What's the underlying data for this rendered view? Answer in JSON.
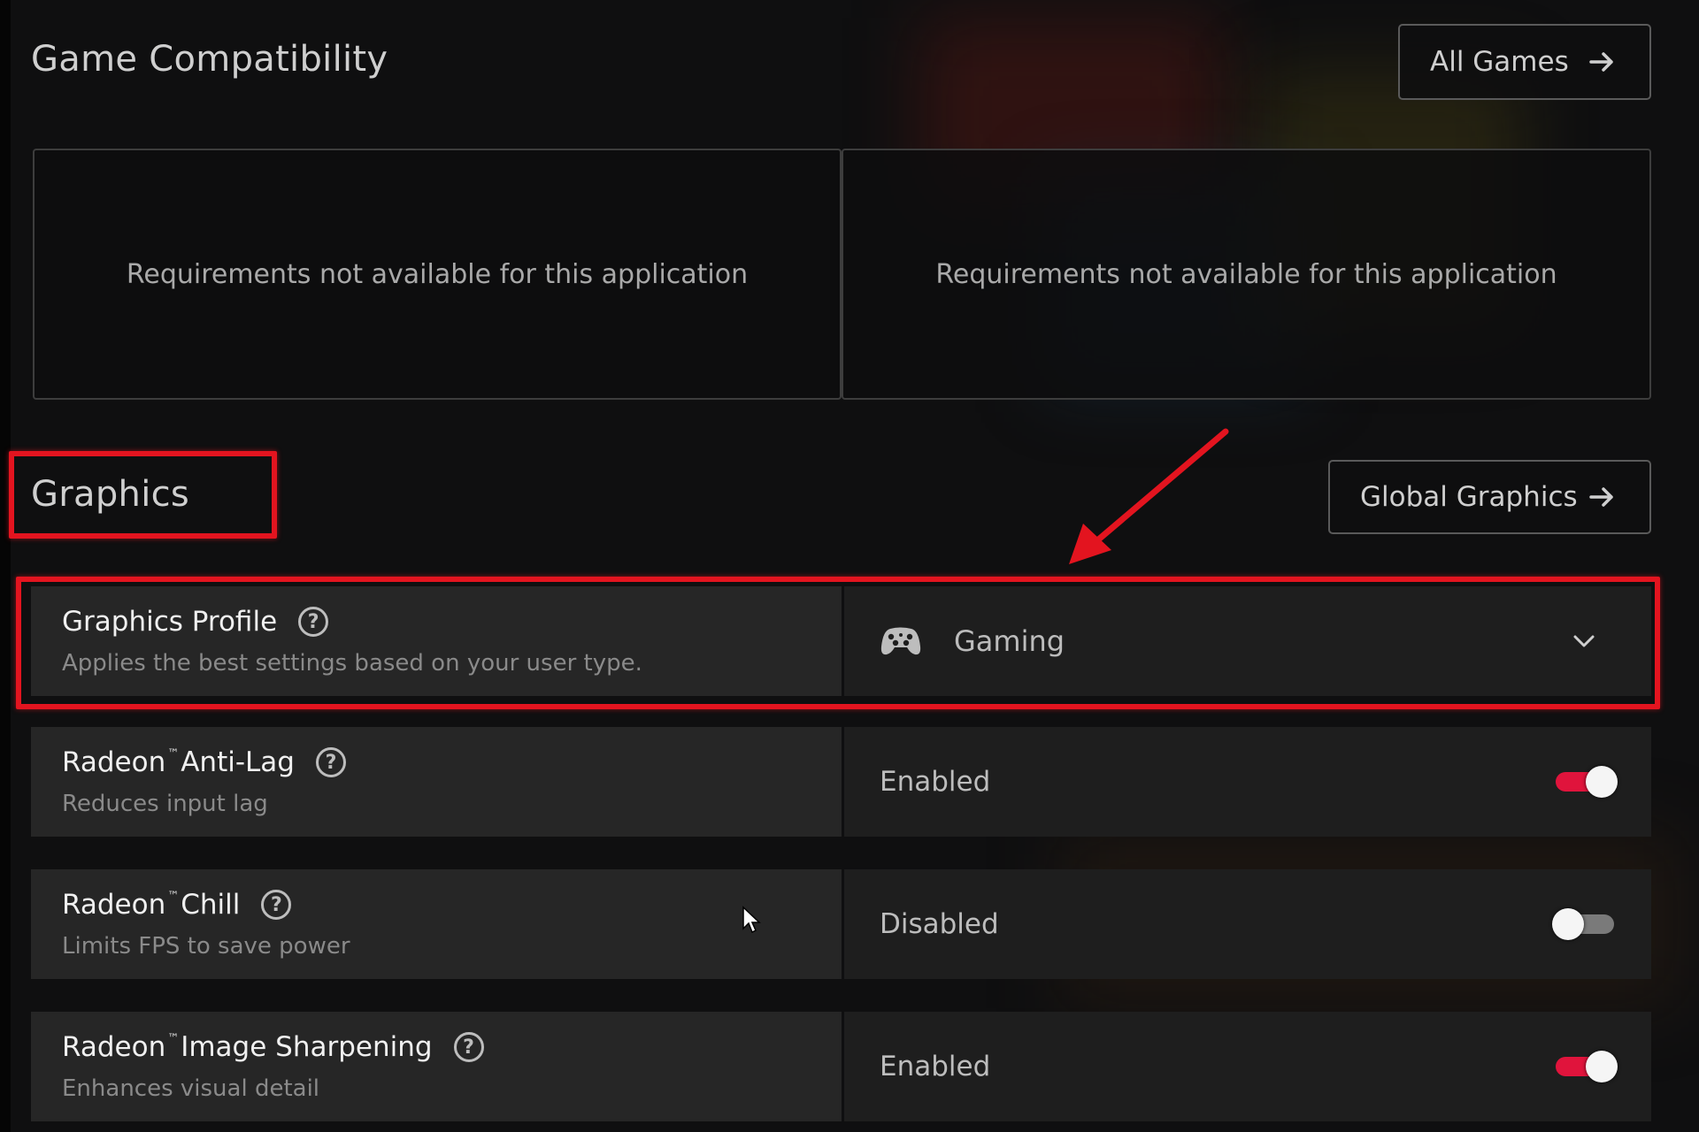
{
  "game_compatibility": {
    "title": "Game Compatibility",
    "all_games_button": "All Games",
    "requirements": [
      "Requirements not available for this application",
      "Requirements not available for this application"
    ]
  },
  "graphics": {
    "title": "Graphics",
    "global_graphics_button": "Global Graphics",
    "profile": {
      "title": "Graphics Profile",
      "description": "Applies the best settings based on your user type.",
      "value": "Gaming",
      "icon": "gamepad-icon"
    },
    "settings": [
      {
        "brand": "Radeon",
        "tm": "™",
        "name": "Anti-Lag",
        "description": "Reduces input lag",
        "state": "Enabled",
        "enabled": true
      },
      {
        "brand": "Radeon",
        "tm": "™",
        "name": "Chill",
        "description": "Limits FPS to save power",
        "state": "Disabled",
        "enabled": false
      },
      {
        "brand": "Radeon",
        "tm": "™",
        "name": "Image Sharpening",
        "description": "Enhances visual detail",
        "state": "Enabled",
        "enabled": true
      }
    ]
  },
  "annotations": {
    "highlight_color": "#e3141f",
    "highlighted": [
      "Graphics",
      "Graphics Profile"
    ]
  },
  "colors": {
    "accent_red": "#e0143c",
    "background": "#0f0f10",
    "row_left": "#262626",
    "row_right": "#1e1e1e"
  },
  "help_glyph": "?"
}
